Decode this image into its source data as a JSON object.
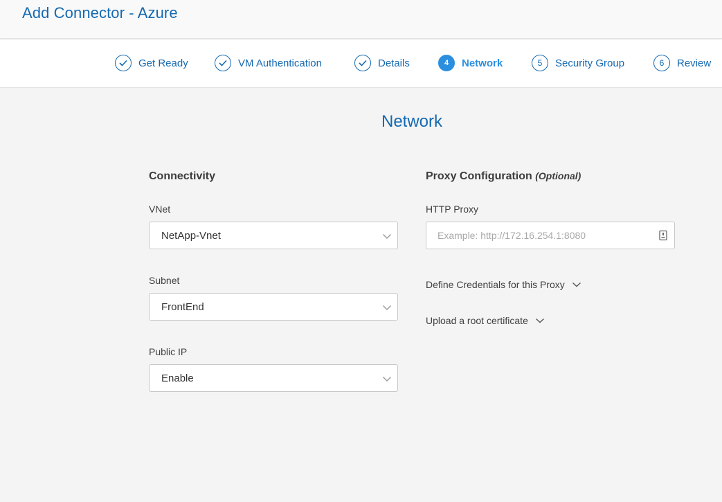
{
  "header": {
    "title": "Add Connector - Azure"
  },
  "steps": [
    {
      "label": "Get Ready",
      "status": "done"
    },
    {
      "label": "VM Authentication",
      "status": "done"
    },
    {
      "label": "Details",
      "status": "done"
    },
    {
      "number": "4",
      "label": "Network",
      "status": "active"
    },
    {
      "number": "5",
      "label": "Security Group",
      "status": "pending"
    },
    {
      "number": "6",
      "label": "Review",
      "status": "pending"
    }
  ],
  "main": {
    "title": "Network",
    "connectivity": {
      "title": "Connectivity",
      "vnet": {
        "label": "VNet",
        "value": "NetApp-Vnet"
      },
      "subnet": {
        "label": "Subnet",
        "value": "FrontEnd"
      },
      "public_ip": {
        "label": "Public IP",
        "value": "Enable"
      }
    },
    "proxy": {
      "title": "Proxy Configuration",
      "optional": "(Optional)",
      "http_proxy": {
        "label": "HTTP Proxy",
        "placeholder": "Example: http://172.16.254.1:8080",
        "value": ""
      },
      "credentials_toggle": "Define Credentials for this Proxy",
      "certificate_toggle": "Upload a root certificate"
    }
  },
  "colors": {
    "brand_blue": "#1469b1",
    "active_blue": "#2b8fe0",
    "background": "#f4f4f4"
  }
}
